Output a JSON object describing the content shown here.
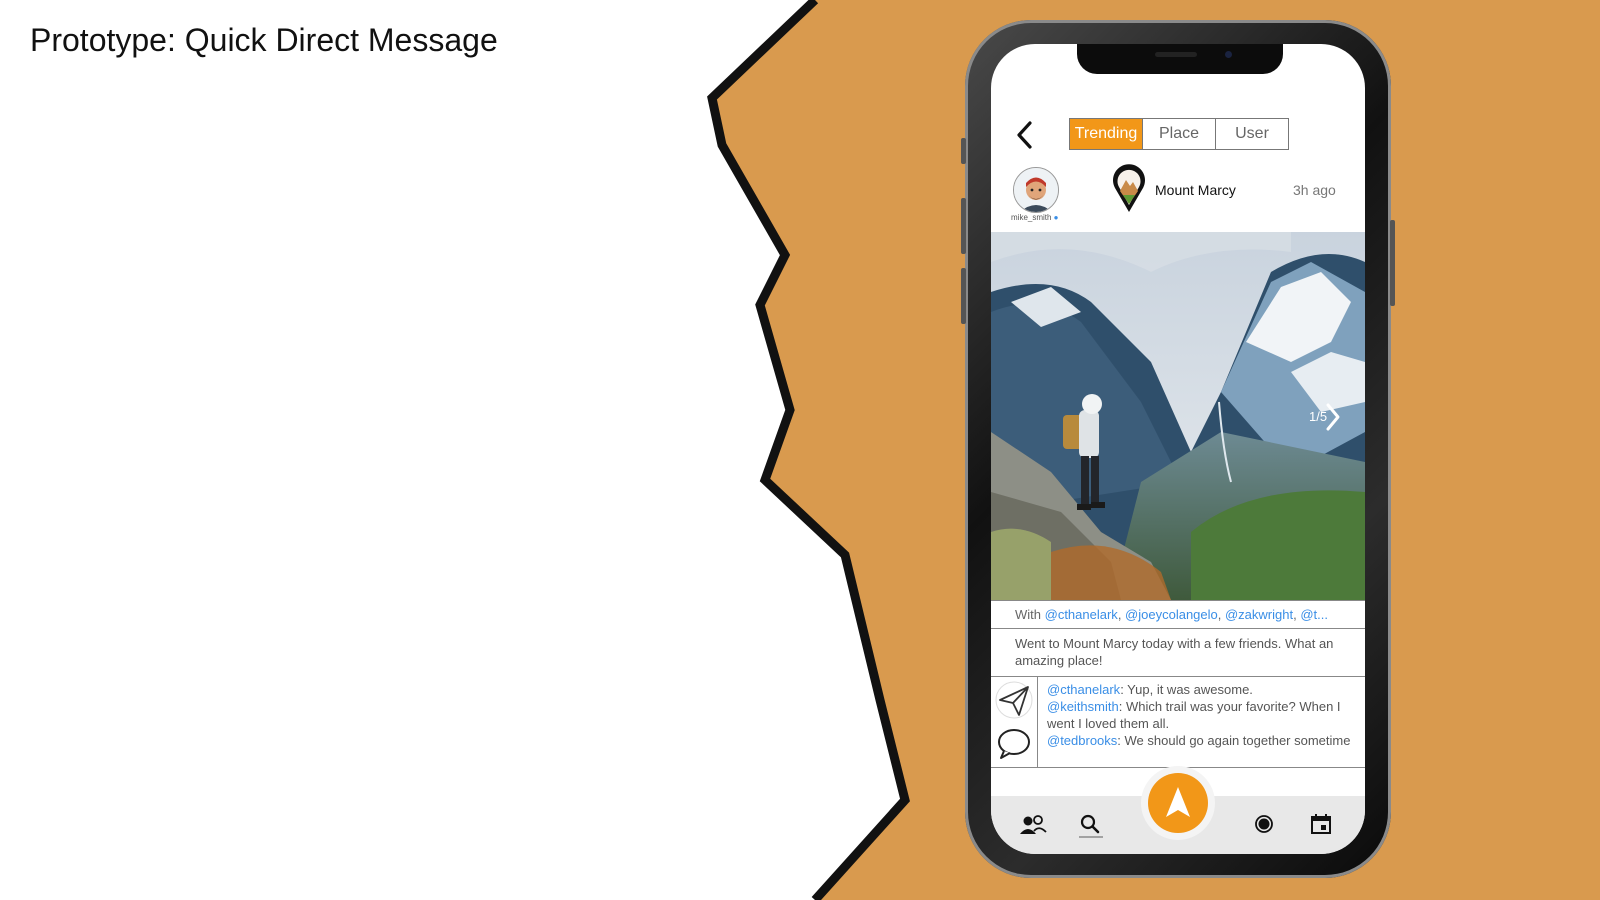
{
  "slide": {
    "title": "Prototype: Quick Direct Message"
  },
  "colors": {
    "accent": "#f29718",
    "background_shape": "#d99a4e",
    "mention": "#3a8ee6"
  },
  "header": {
    "back_icon": "chevron-left-icon",
    "tabs": [
      {
        "label": "Trending",
        "active": true
      },
      {
        "label": "Place",
        "active": false
      },
      {
        "label": "User",
        "active": false
      }
    ]
  },
  "post": {
    "username": "mike_smith",
    "place": "Mount Marcy",
    "time_ago": "3h ago",
    "photo_counter": "1/5",
    "with_prefix": "With ",
    "with_mentions": [
      "@cthanelark",
      "@joeycolangelo",
      "@zakwright",
      "@t..."
    ],
    "caption": "Went to Mount Marcy today with a few friends. What an amazing place!",
    "comments": [
      {
        "user": "@cthanelark",
        "text": ": Yup, it was awesome."
      },
      {
        "user": "@keithsmith",
        "text": ": Which trail was your favorite? When I went I loved them all."
      },
      {
        "user": "@tedbrooks",
        "text": ": We should go again together sometime"
      }
    ],
    "action_icons": [
      "send-icon",
      "comment-icon"
    ]
  },
  "bottom_nav": {
    "icons": [
      "friends-icon",
      "search-icon",
      "navigate-icon",
      "record-icon",
      "calendar-icon"
    ]
  }
}
